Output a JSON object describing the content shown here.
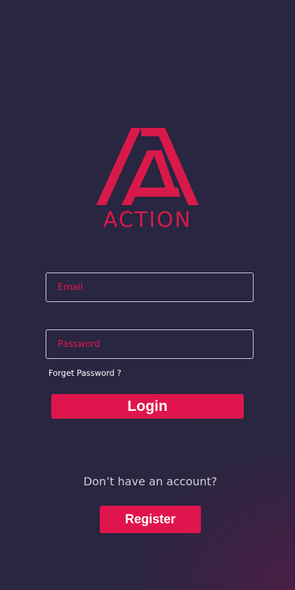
{
  "app": {
    "name": "ACTION"
  },
  "login_form": {
    "email_placeholder": "Email",
    "password_placeholder": "Password",
    "forgot_password_label": "Forget Password ?",
    "login_label": "Login"
  },
  "signup": {
    "prompt": "Don’t have an account?",
    "register_label": "Register"
  },
  "colors": {
    "background": "#282640",
    "accent": "#e0154d",
    "field_border": "#cfd0dc"
  }
}
